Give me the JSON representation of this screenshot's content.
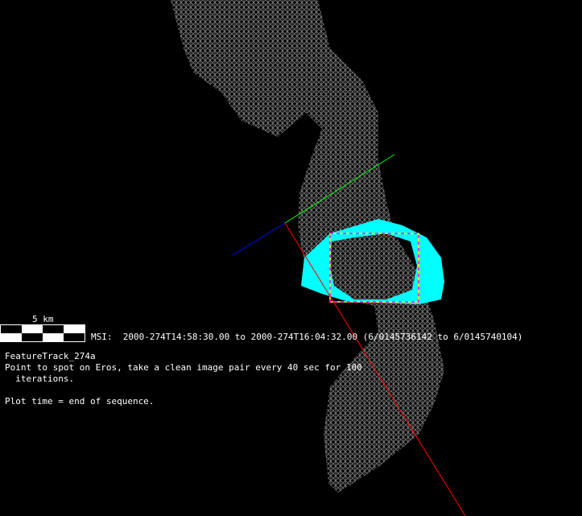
{
  "scale": {
    "label": "5 km"
  },
  "msi_line": "MSI:  2000-274T14:58:30.00 to 2000-274T16:04:32.00 (6/0145736142 to 6/0145740104)",
  "sequence": {
    "name": "FeatureTrack_274a",
    "description_line1": "Point to spot on Eros, take a clean image pair every 40 sec for 100",
    "description_line2": "  iterations.",
    "note": "Plot time = end of sequence."
  },
  "colors": {
    "mesh": "#7a7a7a",
    "footprint": "#00ffff",
    "frame_a": "#ff00ff",
    "frame_b": "#ffff00",
    "axis_x": "#ff0000",
    "axis_y": "#00ff00",
    "axis_z": "#0000ff"
  }
}
